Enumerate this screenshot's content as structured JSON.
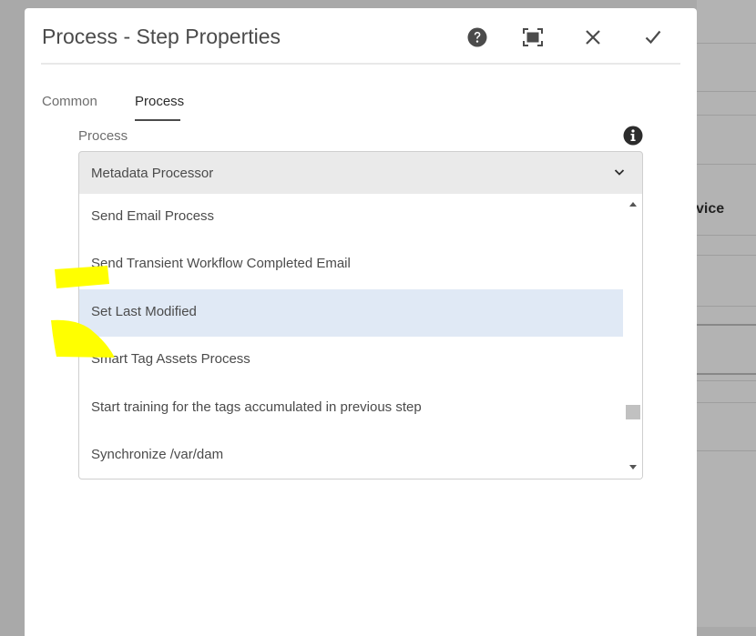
{
  "background": {
    "partial_text": "vice"
  },
  "dialog": {
    "title": "Process - Step Properties",
    "buttons": {
      "help": "help-icon",
      "fullscreen": "fullscreen-icon",
      "close": "close-icon",
      "done": "checkmark-icon"
    }
  },
  "tabs": [
    {
      "label": "Common",
      "active": false
    },
    {
      "label": "Process",
      "active": true
    }
  ],
  "process_field": {
    "label": "Process",
    "selected": "Metadata Processor",
    "options": [
      "Send Email Process",
      "Send Transient Workflow Completed Email",
      "Set Last Modified",
      "Smart Tag Assets Process",
      "Start training for the tags accumulated in previous step",
      "Synchronize /var/dam"
    ],
    "highlighted_option": "Set Last Modified"
  },
  "colors": {
    "highlight": "#e0e9f5",
    "annotation": "#ffff00"
  }
}
